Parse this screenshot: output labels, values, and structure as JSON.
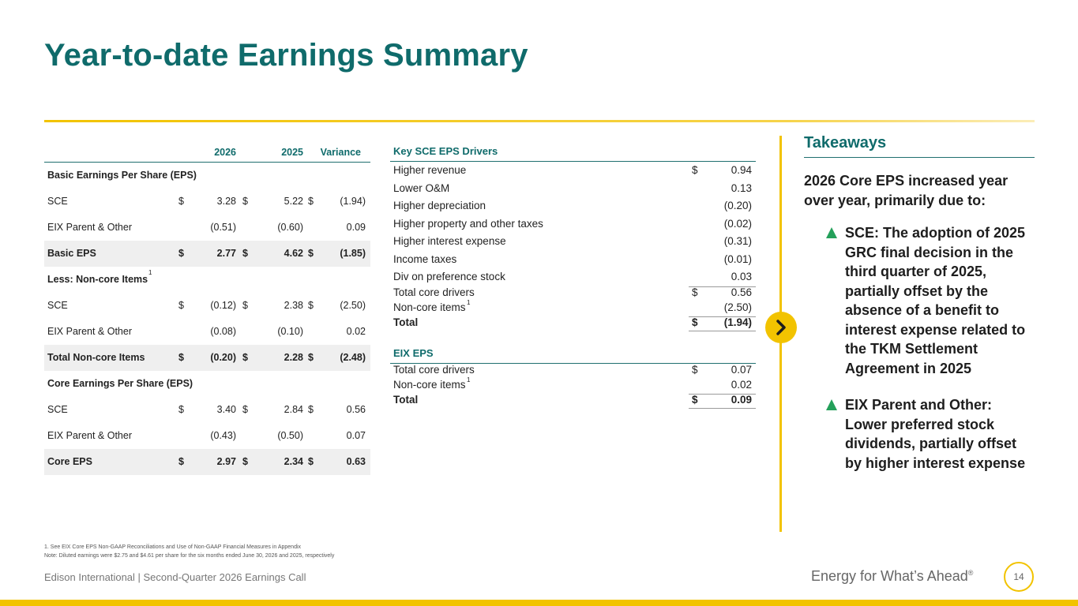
{
  "title": "Year-to-date Earnings Summary",
  "eps_table": {
    "headers": {
      "y2026": "2026",
      "y2025": "2025",
      "variance": "Variance"
    },
    "rows": [
      {
        "label": "Basic Earnings Per Share (EPS)",
        "type": "section"
      },
      {
        "label": "SCE",
        "d1": "$",
        "v1": "3.28",
        "d2": "$",
        "v2": "5.22",
        "d3": "$",
        "v3": "(1.94)"
      },
      {
        "label": "EIX Parent & Other",
        "d1": "",
        "v1": "(0.51)",
        "d2": "",
        "v2": "(0.60)",
        "d3": "",
        "v3": "0.09"
      },
      {
        "label": "Basic EPS",
        "d1": "$",
        "v1": "2.77",
        "d2": "$",
        "v2": "4.62",
        "d3": "$",
        "v3": "(1.85)",
        "type": "total"
      },
      {
        "label": "Less: Non-core Items",
        "sup": "1",
        "type": "section"
      },
      {
        "label": "SCE",
        "d1": "$",
        "v1": "(0.12)",
        "d2": "$",
        "v2": "2.38",
        "d3": "$",
        "v3": "(2.50)"
      },
      {
        "label": "EIX Parent & Other",
        "d1": "",
        "v1": "(0.08)",
        "d2": "",
        "v2": "(0.10)",
        "d3": "",
        "v3": "0.02"
      },
      {
        "label": "Total Non-core Items",
        "d1": "$",
        "v1": "(0.20)",
        "d2": "$",
        "v2": "2.28",
        "d3": "$",
        "v3": "(2.48)",
        "type": "total"
      },
      {
        "label": "Core Earnings Per Share (EPS)",
        "type": "section"
      },
      {
        "label": "SCE",
        "d1": "$",
        "v1": "3.40",
        "d2": "$",
        "v2": "2.84",
        "d3": "$",
        "v3": "0.56"
      },
      {
        "label": "EIX Parent & Other",
        "d1": "",
        "v1": "(0.43)",
        "d2": "",
        "v2": "(0.50)",
        "d3": "",
        "v3": "0.07"
      },
      {
        "label": "Core EPS",
        "d1": "$",
        "v1": "2.97",
        "d2": "$",
        "v2": "2.34",
        "d3": "$",
        "v3": "0.63",
        "type": "total"
      }
    ]
  },
  "sce_drivers": {
    "header": "Key SCE EPS Drivers",
    "rows": [
      {
        "label": "Higher revenue",
        "dollar": "$",
        "value": "0.94"
      },
      {
        "label": "Lower O&M",
        "dollar": "",
        "value": "0.13"
      },
      {
        "label": "Higher depreciation",
        "dollar": "",
        "value": "(0.20)"
      },
      {
        "label": "Higher property and other taxes",
        "dollar": "",
        "value": "(0.02)"
      },
      {
        "label": "Higher interest expense",
        "dollar": "",
        "value": "(0.31)"
      },
      {
        "label": "Income taxes",
        "dollar": "",
        "value": "(0.01)"
      },
      {
        "label": "Div on preference stock",
        "dollar": "",
        "value": "0.03"
      },
      {
        "label": "Total core drivers",
        "dollar": "$",
        "value": "0.56"
      },
      {
        "label": "Non-core items",
        "sup": "1",
        "dollar": "",
        "value": "(2.50)"
      },
      {
        "label": "Total",
        "dollar": "$",
        "value": "(1.94)"
      }
    ]
  },
  "eix_eps": {
    "header": "EIX EPS",
    "rows": [
      {
        "label": "Total core drivers",
        "dollar": "$",
        "value": "0.07"
      },
      {
        "label": "Non-core items",
        "sup": "1",
        "dollar": "",
        "value": "0.02"
      },
      {
        "label": "Total",
        "dollar": "$",
        "value": "0.09"
      }
    ]
  },
  "takeaways": {
    "title": "Takeaways",
    "intro": "2026 Core EPS increased year over year, primarily due to:",
    "bullets": [
      "SCE: The adoption of 2025 GRC final decision in the third quarter of 2025, partially offset by the absence of a benefit to interest expense related to the TKM Settlement Agreement in 2025",
      "EIX Parent and Other: Lower preferred stock dividends, partially offset by higher interest expense"
    ]
  },
  "footnotes": {
    "note1": "1.   See EIX Core EPS Non-GAAP Reconciliations and Use of Non-GAAP Financial Measures in Appendix",
    "note2": "Note: Diluted earnings were $2.75 and $4.61 per share for the six months ended June 30, 2026 and 2025, respectively"
  },
  "footer": {
    "left": "Edison International |  Second-Quarter 2026 Earnings Call",
    "tagline": "Energy for What’s Ahead",
    "tagline_mark": "®",
    "page": "14"
  },
  "colors": {
    "teal": "#0f6b6b",
    "gold": "#f2c300",
    "green": "#24a05a"
  },
  "icons": {
    "arrow": "chevron-right-icon",
    "bullet": "triangle-up-icon"
  }
}
